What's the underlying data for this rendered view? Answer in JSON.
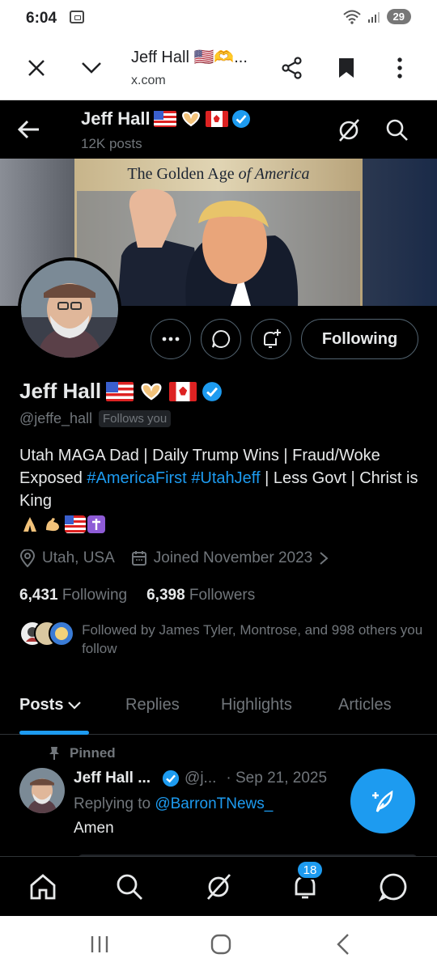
{
  "status_bar": {
    "time": "6:04",
    "battery": "29"
  },
  "browser": {
    "title": "Jeff Hall 🇺🇸🫶...",
    "url": "x.com"
  },
  "profile": {
    "nav_name": "Jeff Hall",
    "posts_count": "12K posts",
    "banner_title_prefix": "The Golden Age",
    "banner_title_suffix": " of America",
    "follow_button": "Following",
    "name": "Jeff Hall",
    "handle": "@jeffe_hall",
    "follows_you": "Follows you",
    "bio_part1": "Utah MAGA Dad | Daily Trump Wins | Fraud/Woke Exposed ",
    "bio_tag1": "#AmericaFirst",
    "bio_tag2": "#UtahJeff",
    "bio_part2": " | Less Govt | Christ is King",
    "location": "Utah, USA",
    "joined": "Joined November 2023",
    "following_count": "6,431",
    "following_label": "Following",
    "followers_count": "6,398",
    "followers_label": "Followers",
    "followed_by": "Followed by James Tyler, Montrose, and 998 others you follow"
  },
  "tabs": [
    "Posts",
    "Replies",
    "Highlights",
    "Articles"
  ],
  "tweet": {
    "pinned_label": "Pinned",
    "author": "Jeff Hall ...",
    "handle": "@j...",
    "date": "· Sep 21, 2025",
    "replying_prefix": "Replying to ",
    "replying_to": "@BarronTNews_",
    "text": "Amen"
  },
  "bottom_nav": {
    "notifications_badge": "18"
  },
  "colors": {
    "accent": "#1d9bf0",
    "background": "#000000",
    "muted": "#71767b"
  }
}
